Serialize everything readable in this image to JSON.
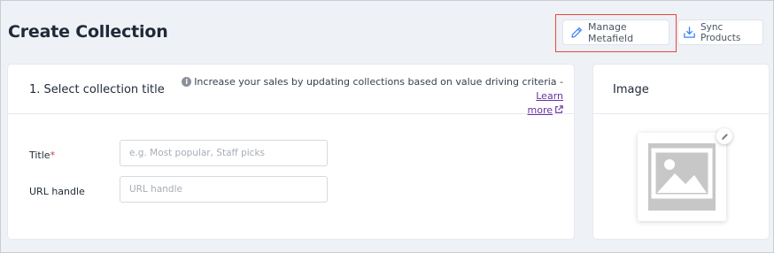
{
  "header": {
    "title": "Create Collection",
    "manage_metafield_label": "Manage Metafield",
    "sync_products_label": "Sync Products"
  },
  "section": {
    "title": "1. Select collection title",
    "hint_text": "Increase your sales by updating collections based on value driving criteria - ",
    "hint_link_part1": "Learn",
    "hint_link_part2": "more"
  },
  "form": {
    "title_label": "Title",
    "title_required_mark": "*",
    "title_placeholder": "e.g. Most popular, Staff picks",
    "url_label": "URL handle",
    "url_placeholder": "URL handle"
  },
  "image_panel": {
    "title": "Image"
  },
  "colors": {
    "accent": "#3b82f6",
    "link": "#6b2fa0",
    "highlight_border": "#e3493b",
    "required": "#d23b3b"
  },
  "icons": {
    "manage": "pencil-icon",
    "sync": "download-icon",
    "info": "info-icon",
    "external": "external-link-icon",
    "placeholder": "image-placeholder-icon",
    "edit": "pencil-icon"
  }
}
